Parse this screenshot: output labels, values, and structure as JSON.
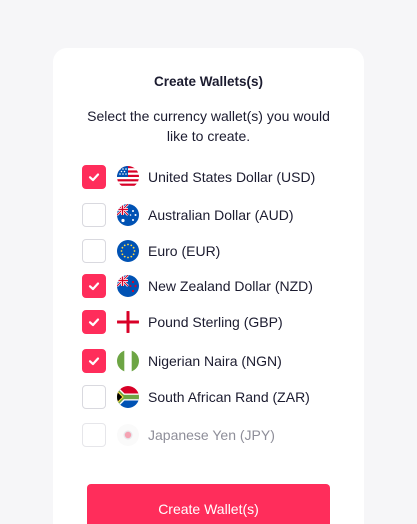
{
  "dialog": {
    "title": "Create Wallets(s)",
    "subtitle": "Select the currency wallet(s) you would like to create."
  },
  "currencies": [
    {
      "label": "United States Dollar (USD)",
      "checked": true,
      "flag": "us-flag-icon"
    },
    {
      "label": "Australian Dollar (AUD)",
      "checked": false,
      "flag": "au-flag-icon"
    },
    {
      "label": "Euro (EUR)",
      "checked": false,
      "flag": "eu-flag-icon"
    },
    {
      "label": "New Zealand Dollar (NZD)",
      "checked": true,
      "flag": "nz-flag-icon"
    },
    {
      "label": "Pound Sterling (GBP)",
      "checked": true,
      "flag": "england-flag-icon"
    },
    {
      "label": "Nigerian Naira (NGN)",
      "checked": true,
      "flag": "ng-flag-icon"
    },
    {
      "label": "South African Rand (ZAR)",
      "checked": false,
      "flag": "za-flag-icon"
    },
    {
      "label": "Japanese Yen (JPY)",
      "checked": false,
      "disabled": true,
      "flag": "jp-flag-icon"
    }
  ],
  "actions": {
    "create_label": "Create Wallet(s)"
  },
  "colors": {
    "accent": "#ff2d5b",
    "text": "#1b1b2f",
    "muted": "#8e8e99",
    "background": "#f6f6f8"
  }
}
